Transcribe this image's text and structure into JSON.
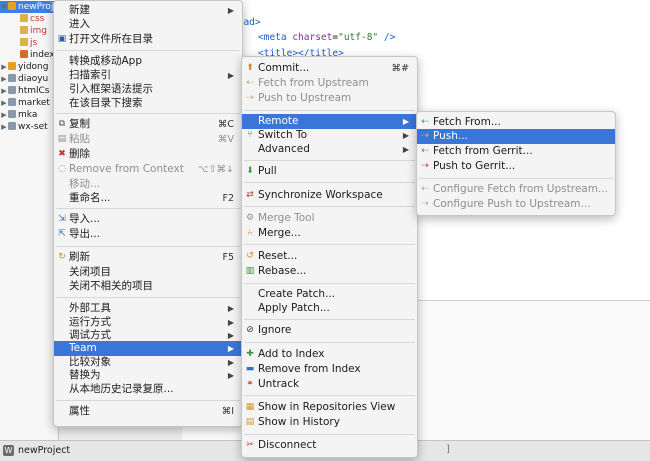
{
  "tree": {
    "items": [
      {
        "label": "newProject",
        "twisty": "▼"
      },
      {
        "label": "css",
        "twisty": ""
      },
      {
        "label": "img",
        "twisty": ""
      },
      {
        "label": "js",
        "twisty": ""
      },
      {
        "label": "index",
        "twisty": ""
      },
      {
        "label": "yidong",
        "twisty": "▶"
      },
      {
        "label": "diaoyu",
        "twisty": "▶"
      },
      {
        "label": "htmlCs",
        "twisty": "▶"
      },
      {
        "label": "market",
        "twisty": "▶"
      },
      {
        "label": "mka",
        "twisty": "▶"
      },
      {
        "label": "wx-set",
        "twisty": "▶"
      }
    ]
  },
  "editor": {
    "line1": "head>",
    "line2a": "<meta ",
    "line2b": "charset",
    "line2c": "=",
    "line2d": "\"utf-8\"",
    "line2e": " />",
    "line3": "<title></title>"
  },
  "status": {
    "project": "newProject",
    "bracket": "]"
  },
  "context_menu": {
    "items": [
      {
        "label": "新建",
        "arrow": "▶"
      },
      {
        "label": "进入"
      },
      {
        "label": "打开文件所在目录",
        "icon": "▣"
      },
      {
        "label": "转换成移动App"
      },
      {
        "label": "扫描索引",
        "arrow": "▶"
      },
      {
        "label": "引入框架语法提示"
      },
      {
        "label": "在该目录下搜索"
      },
      {
        "label": "复制",
        "icon": "⧉",
        "shortcut": "⌘C"
      },
      {
        "label": "粘贴",
        "icon": "▤",
        "shortcut": "⌘V"
      },
      {
        "label": "删除",
        "icon": "✖"
      },
      {
        "label": "Remove from Context",
        "icon": "◌",
        "shortcut": "⌥⇧⌘↓"
      },
      {
        "label": "移动..."
      },
      {
        "label": "重命名...",
        "shortcut": "F2"
      },
      {
        "label": "导入...",
        "icon": "⇲"
      },
      {
        "label": "导出...",
        "icon": "⇱"
      },
      {
        "label": "刷新",
        "icon": "↻",
        "shortcut": "F5"
      },
      {
        "label": "关闭项目"
      },
      {
        "label": "关闭不相关的项目"
      },
      {
        "label": "外部工具",
        "arrow": "▶"
      },
      {
        "label": "运行方式",
        "arrow": "▶"
      },
      {
        "label": "调试方式",
        "arrow": "▶"
      },
      {
        "label": "Team",
        "arrow": "▶"
      },
      {
        "label": "比较对象",
        "arrow": "▶"
      },
      {
        "label": "替换为",
        "arrow": "▶"
      },
      {
        "label": "从本地历史记录复原..."
      },
      {
        "label": "属性",
        "shortcut": "⌘I"
      }
    ]
  },
  "team_menu": {
    "items": [
      {
        "label": "Commit...",
        "icon": "⬆",
        "shortcut": "⌘#"
      },
      {
        "label": "Fetch from Upstream",
        "icon": "⇠"
      },
      {
        "label": "Push to Upstream",
        "icon": "⇢"
      },
      {
        "label": "Remote",
        "arrow": "▶"
      },
      {
        "label": "Switch To",
        "icon": "⑂",
        "arrow": "▶"
      },
      {
        "label": "Advanced",
        "arrow": "▶"
      },
      {
        "label": "Pull",
        "icon": "⬇"
      },
      {
        "label": "Synchronize Workspace",
        "icon": "⇄"
      },
      {
        "label": "Merge Tool",
        "icon": "⚙"
      },
      {
        "label": "Merge...",
        "icon": "⑃"
      },
      {
        "label": "Reset...",
        "icon": "↺"
      },
      {
        "label": "Rebase...",
        "icon": "▥"
      },
      {
        "label": "Create Patch..."
      },
      {
        "label": "Apply Patch..."
      },
      {
        "label": "Ignore",
        "icon": "⊘"
      },
      {
        "label": "Add to Index",
        "icon": "✚"
      },
      {
        "label": "Remove from Index",
        "icon": "▬"
      },
      {
        "label": "Untrack",
        "icon": "⚭"
      },
      {
        "label": "Show in Repositories View",
        "icon": "▦"
      },
      {
        "label": "Show in History",
        "icon": "▤"
      },
      {
        "label": "Disconnect",
        "icon": "✂"
      }
    ]
  },
  "remote_menu": {
    "items": [
      {
        "label": "Fetch From...",
        "icon": "⇠"
      },
      {
        "label": "Push...",
        "icon": "⇢"
      },
      {
        "label": "Fetch from Gerrit...",
        "icon": "⇠"
      },
      {
        "label": "Push to Gerrit...",
        "icon": "⇢"
      },
      {
        "label": "Configure Fetch from Upstream...",
        "icon": "⇠"
      },
      {
        "label": "Configure Push to Upstream...",
        "icon": "⇢"
      }
    ]
  },
  "colors": {
    "accent": "#3a76d8",
    "menu_bg": "#f4f4f4",
    "disabled": "#8e8e8e"
  }
}
